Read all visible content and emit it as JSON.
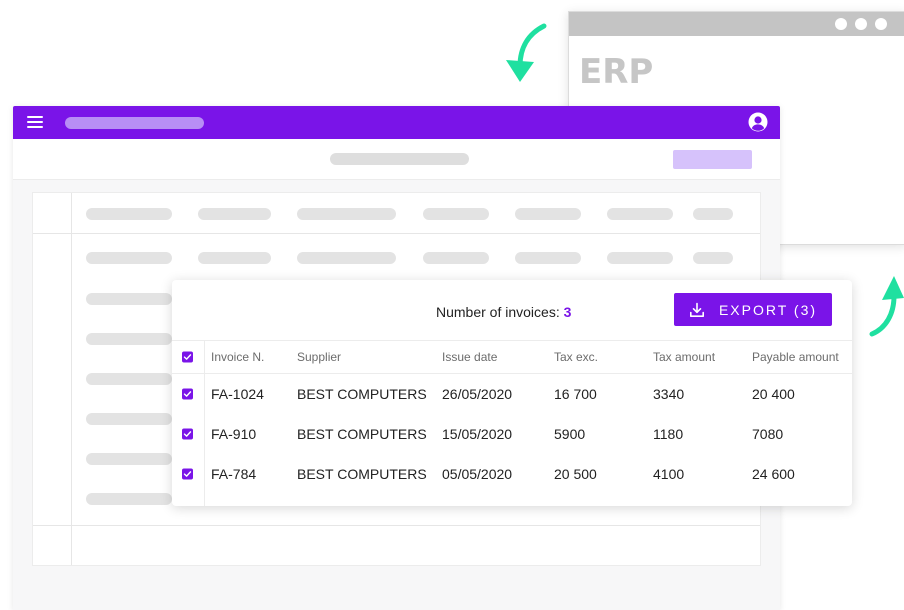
{
  "erp": {
    "title": "ERP"
  },
  "invoices": {
    "count_label": "Number of invoices:",
    "count_value": "3",
    "export_label": "EXPORT (3)",
    "columns": [
      "Invoice N.",
      "Supplier",
      "Issue date",
      "Tax exc.",
      "Tax amount",
      "Payable amount"
    ],
    "rows": [
      [
        "FA-1024",
        "BEST COMPUTERS",
        "26/05/2020",
        "16 700",
        "3340",
        "20 400"
      ],
      [
        "FA-910",
        "BEST COMPUTERS",
        "15/05/2020",
        "5900",
        "1180",
        "7080"
      ],
      [
        "FA-784",
        "BEST COMPUTERS",
        "05/05/2020",
        "20 500",
        "4100",
        "24 600"
      ]
    ]
  },
  "icons": {
    "header_menu": "hamburger-icon",
    "header_user": "user-icon",
    "export": "download-icon",
    "checkbox": "check-icon",
    "arrows": "curved-arrow-icon"
  },
  "colors": {
    "accent": "#7a14e8",
    "accent_light": "#d6c2fb",
    "arrow": "#1fe0a0",
    "placeholder": "#e3e3e3"
  }
}
